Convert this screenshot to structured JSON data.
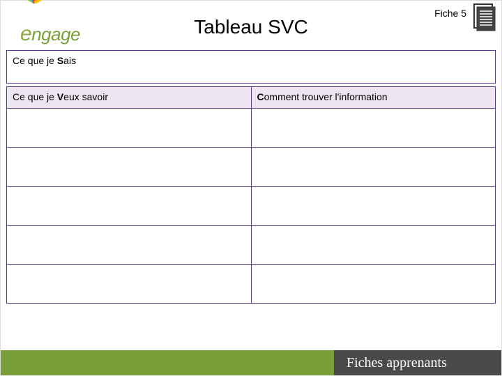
{
  "header": {
    "logo_text_e": "e",
    "logo_text_rest": "ngage",
    "title": "Tableau SVC",
    "fiche_label": "Fiche 5"
  },
  "sais": {
    "prefix": "Ce que je ",
    "letter": "S",
    "suffix": "ais"
  },
  "columns": {
    "left_prefix": "Ce que je ",
    "left_letter": "V",
    "left_suffix": "eux savoir",
    "right_letter": "C",
    "right_suffix": "omment trouver l'information"
  },
  "footer": {
    "label": "Fiches apprenants"
  },
  "logo_petals": [
    {
      "color": "#8bc34a",
      "rot": -60
    },
    {
      "color": "#2196f3",
      "rot": -36
    },
    {
      "color": "#e91e63",
      "rot": -12
    },
    {
      "color": "#f44336",
      "rot": 12
    },
    {
      "color": "#ff9800",
      "rot": 36
    },
    {
      "color": "#ffc107",
      "rot": 60
    }
  ]
}
